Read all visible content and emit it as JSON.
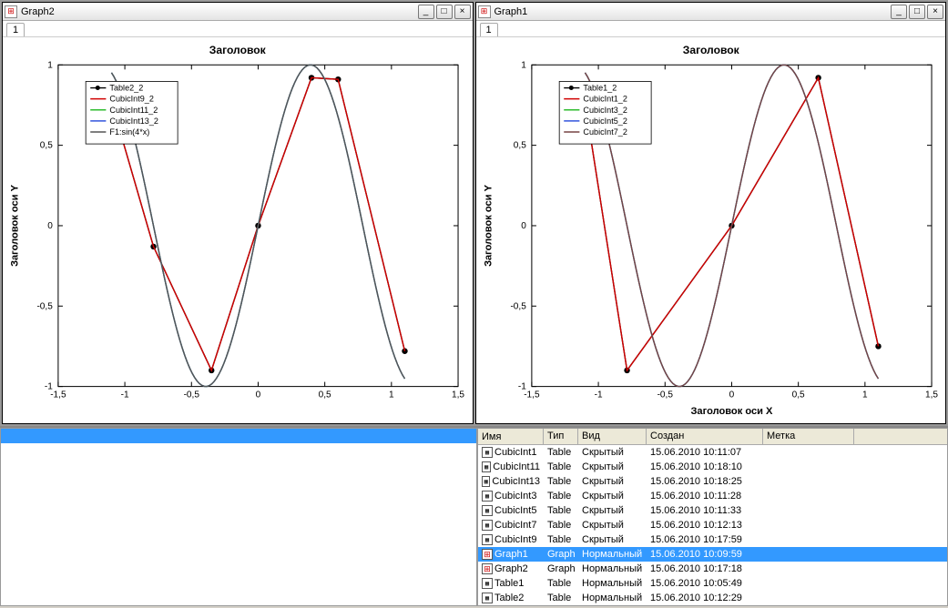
{
  "graph2": {
    "window_title": "Graph2",
    "tab": "1",
    "title": "Заголовок",
    "ylabel": "Заголовок оси Y",
    "xlabel": "",
    "legend": [
      "Table2_2",
      "CubicInt9_2",
      "CubicInt11_2",
      "CubicInt13_2",
      "F1:sin(4*x)"
    ]
  },
  "graph1": {
    "window_title": "Graph1",
    "tab": "1",
    "title": "Заголовок",
    "ylabel": "Заголовок оси Y",
    "xlabel": "Заголовок оси X",
    "legend": [
      "Table1_2",
      "CubicInt1_2",
      "CubicInt3_2",
      "CubicInt5_2",
      "CubicInt7_2"
    ]
  },
  "table": {
    "columns": {
      "name": "Имя",
      "type": "Тип",
      "view": "Вид",
      "created": "Создан",
      "label": "Метка"
    },
    "rows": [
      {
        "icon": "table",
        "name": "CubicInt1",
        "type": "Table",
        "view": "Скрытый",
        "created": "15.06.2010 10:11:07",
        "label": "",
        "sel": false
      },
      {
        "icon": "table",
        "name": "CubicInt11",
        "type": "Table",
        "view": "Скрытый",
        "created": "15.06.2010 10:18:10",
        "label": "",
        "sel": false
      },
      {
        "icon": "table",
        "name": "CubicInt13",
        "type": "Table",
        "view": "Скрытый",
        "created": "15.06.2010 10:18:25",
        "label": "",
        "sel": false
      },
      {
        "icon": "table",
        "name": "CubicInt3",
        "type": "Table",
        "view": "Скрытый",
        "created": "15.06.2010 10:11:28",
        "label": "",
        "sel": false
      },
      {
        "icon": "table",
        "name": "CubicInt5",
        "type": "Table",
        "view": "Скрытый",
        "created": "15.06.2010 10:11:33",
        "label": "",
        "sel": false
      },
      {
        "icon": "table",
        "name": "CubicInt7",
        "type": "Table",
        "view": "Скрытый",
        "created": "15.06.2010 10:12:13",
        "label": "",
        "sel": false
      },
      {
        "icon": "table",
        "name": "CubicInt9",
        "type": "Table",
        "view": "Скрытый",
        "created": "15.06.2010 10:17:59",
        "label": "",
        "sel": false
      },
      {
        "icon": "graph",
        "name": "Graph1",
        "type": "Graph",
        "view": "Нормальный",
        "created": "15.06.2010 10:09:59",
        "label": "",
        "sel": true
      },
      {
        "icon": "graph",
        "name": "Graph2",
        "type": "Graph",
        "view": "Нормальный",
        "created": "15.06.2010 10:17:18",
        "label": "",
        "sel": false
      },
      {
        "icon": "table",
        "name": "Table1",
        "type": "Table",
        "view": "Нормальный",
        "created": "15.06.2010 10:05:49",
        "label": "",
        "sel": false
      },
      {
        "icon": "table",
        "name": "Table2",
        "type": "Table",
        "view": "Нормальный",
        "created": "15.06.2010 10:12:29",
        "label": "",
        "sel": false
      }
    ]
  },
  "window_buttons": {
    "min": "_",
    "max": "□",
    "close": "×"
  },
  "chart_data": [
    {
      "id": "graph2",
      "type": "line",
      "title": "Заголовок",
      "xlabel": "",
      "ylabel": "Заголовок оси Y",
      "xlim": [
        -1.5,
        1.5
      ],
      "ylim": [
        -1,
        1
      ],
      "x_ticks": [
        -1.5,
        -1,
        -0.5,
        0,
        0.5,
        1,
        1.5
      ],
      "y_ticks": [
        -1,
        -0.5,
        0,
        0.5,
        1
      ],
      "series": [
        {
          "name": "Table2_2",
          "color": "#000",
          "marker": true,
          "x": [
            -1.1,
            -0.785,
            -0.35,
            0,
            0.4,
            0.6,
            1.1
          ],
          "y": [
            0.77,
            -0.13,
            -0.9,
            0,
            0.92,
            0.91,
            -0.78
          ]
        },
        {
          "name": "CubicInt9_2",
          "color": "#d00000",
          "x": [
            -1.1,
            -0.785,
            -0.35,
            0,
            0.4,
            0.6,
            1.1
          ],
          "y": [
            0.77,
            -0.13,
            -0.9,
            0,
            0.92,
            0.91,
            -0.78
          ]
        },
        {
          "name": "CubicInt11_2",
          "color": "#2dbb2d",
          "smooth": true,
          "func": "sin4x"
        },
        {
          "name": "CubicInt13_2",
          "color": "#3355dd",
          "smooth": true,
          "func": "sin4x"
        },
        {
          "name": "F1:sin(4*x)",
          "color": "#555",
          "smooth": true,
          "func": "sin4x"
        }
      ]
    },
    {
      "id": "graph1",
      "type": "line",
      "title": "Заголовок",
      "xlabel": "Заголовок оси X",
      "ylabel": "Заголовок оси Y",
      "xlim": [
        -1.5,
        1.5
      ],
      "ylim": [
        -1,
        1
      ],
      "x_ticks": [
        -1.5,
        -1,
        -0.5,
        0,
        0.5,
        1,
        1.5
      ],
      "y_ticks": [
        -1,
        -0.5,
        0,
        0.5,
        1
      ],
      "series": [
        {
          "name": "Table1_2",
          "color": "#000",
          "marker": true,
          "x": [
            -1.1,
            -0.785,
            0,
            0.65,
            1.1
          ],
          "y": [
            0.77,
            -0.9,
            0,
            0.92,
            -0.75
          ]
        },
        {
          "name": "CubicInt1_2",
          "color": "#d00000",
          "x": [
            -1.1,
            -0.785,
            0,
            0.65,
            1.1
          ],
          "y": [
            0.77,
            -0.9,
            0,
            0.92,
            -0.75
          ]
        },
        {
          "name": "CubicInt3_2",
          "color": "#2dbb2d",
          "smooth": true,
          "func": "sin4x"
        },
        {
          "name": "CubicInt5_2",
          "color": "#3355dd",
          "smooth": true,
          "func": "sin4x"
        },
        {
          "name": "CubicInt7_2",
          "color": "#774444",
          "smooth": true,
          "func": "sin4x"
        }
      ]
    }
  ]
}
